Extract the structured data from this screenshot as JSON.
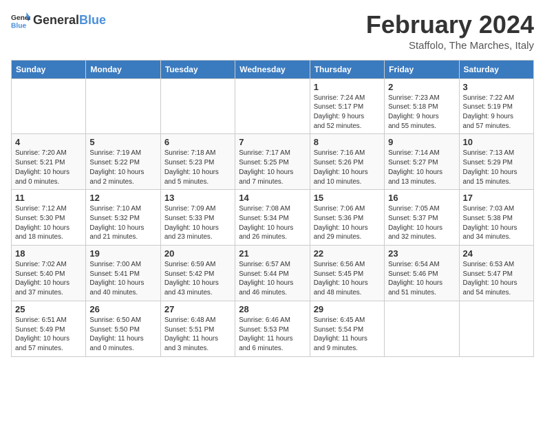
{
  "header": {
    "logo_general": "General",
    "logo_blue": "Blue",
    "title": "February 2024",
    "subtitle": "Staffolo, The Marches, Italy"
  },
  "weekdays": [
    "Sunday",
    "Monday",
    "Tuesday",
    "Wednesday",
    "Thursday",
    "Friday",
    "Saturday"
  ],
  "weeks": [
    [
      {
        "day": "",
        "info": ""
      },
      {
        "day": "",
        "info": ""
      },
      {
        "day": "",
        "info": ""
      },
      {
        "day": "",
        "info": ""
      },
      {
        "day": "1",
        "info": "Sunrise: 7:24 AM\nSunset: 5:17 PM\nDaylight: 9 hours\nand 52 minutes."
      },
      {
        "day": "2",
        "info": "Sunrise: 7:23 AM\nSunset: 5:18 PM\nDaylight: 9 hours\nand 55 minutes."
      },
      {
        "day": "3",
        "info": "Sunrise: 7:22 AM\nSunset: 5:19 PM\nDaylight: 9 hours\nand 57 minutes."
      }
    ],
    [
      {
        "day": "4",
        "info": "Sunrise: 7:20 AM\nSunset: 5:21 PM\nDaylight: 10 hours\nand 0 minutes."
      },
      {
        "day": "5",
        "info": "Sunrise: 7:19 AM\nSunset: 5:22 PM\nDaylight: 10 hours\nand 2 minutes."
      },
      {
        "day": "6",
        "info": "Sunrise: 7:18 AM\nSunset: 5:23 PM\nDaylight: 10 hours\nand 5 minutes."
      },
      {
        "day": "7",
        "info": "Sunrise: 7:17 AM\nSunset: 5:25 PM\nDaylight: 10 hours\nand 7 minutes."
      },
      {
        "day": "8",
        "info": "Sunrise: 7:16 AM\nSunset: 5:26 PM\nDaylight: 10 hours\nand 10 minutes."
      },
      {
        "day": "9",
        "info": "Sunrise: 7:14 AM\nSunset: 5:27 PM\nDaylight: 10 hours\nand 13 minutes."
      },
      {
        "day": "10",
        "info": "Sunrise: 7:13 AM\nSunset: 5:29 PM\nDaylight: 10 hours\nand 15 minutes."
      }
    ],
    [
      {
        "day": "11",
        "info": "Sunrise: 7:12 AM\nSunset: 5:30 PM\nDaylight: 10 hours\nand 18 minutes."
      },
      {
        "day": "12",
        "info": "Sunrise: 7:10 AM\nSunset: 5:32 PM\nDaylight: 10 hours\nand 21 minutes."
      },
      {
        "day": "13",
        "info": "Sunrise: 7:09 AM\nSunset: 5:33 PM\nDaylight: 10 hours\nand 23 minutes."
      },
      {
        "day": "14",
        "info": "Sunrise: 7:08 AM\nSunset: 5:34 PM\nDaylight: 10 hours\nand 26 minutes."
      },
      {
        "day": "15",
        "info": "Sunrise: 7:06 AM\nSunset: 5:36 PM\nDaylight: 10 hours\nand 29 minutes."
      },
      {
        "day": "16",
        "info": "Sunrise: 7:05 AM\nSunset: 5:37 PM\nDaylight: 10 hours\nand 32 minutes."
      },
      {
        "day": "17",
        "info": "Sunrise: 7:03 AM\nSunset: 5:38 PM\nDaylight: 10 hours\nand 34 minutes."
      }
    ],
    [
      {
        "day": "18",
        "info": "Sunrise: 7:02 AM\nSunset: 5:40 PM\nDaylight: 10 hours\nand 37 minutes."
      },
      {
        "day": "19",
        "info": "Sunrise: 7:00 AM\nSunset: 5:41 PM\nDaylight: 10 hours\nand 40 minutes."
      },
      {
        "day": "20",
        "info": "Sunrise: 6:59 AM\nSunset: 5:42 PM\nDaylight: 10 hours\nand 43 minutes."
      },
      {
        "day": "21",
        "info": "Sunrise: 6:57 AM\nSunset: 5:44 PM\nDaylight: 10 hours\nand 46 minutes."
      },
      {
        "day": "22",
        "info": "Sunrise: 6:56 AM\nSunset: 5:45 PM\nDaylight: 10 hours\nand 48 minutes."
      },
      {
        "day": "23",
        "info": "Sunrise: 6:54 AM\nSunset: 5:46 PM\nDaylight: 10 hours\nand 51 minutes."
      },
      {
        "day": "24",
        "info": "Sunrise: 6:53 AM\nSunset: 5:47 PM\nDaylight: 10 hours\nand 54 minutes."
      }
    ],
    [
      {
        "day": "25",
        "info": "Sunrise: 6:51 AM\nSunset: 5:49 PM\nDaylight: 10 hours\nand 57 minutes."
      },
      {
        "day": "26",
        "info": "Sunrise: 6:50 AM\nSunset: 5:50 PM\nDaylight: 11 hours\nand 0 minutes."
      },
      {
        "day": "27",
        "info": "Sunrise: 6:48 AM\nSunset: 5:51 PM\nDaylight: 11 hours\nand 3 minutes."
      },
      {
        "day": "28",
        "info": "Sunrise: 6:46 AM\nSunset: 5:53 PM\nDaylight: 11 hours\nand 6 minutes."
      },
      {
        "day": "29",
        "info": "Sunrise: 6:45 AM\nSunset: 5:54 PM\nDaylight: 11 hours\nand 9 minutes."
      },
      {
        "day": "",
        "info": ""
      },
      {
        "day": "",
        "info": ""
      }
    ]
  ]
}
